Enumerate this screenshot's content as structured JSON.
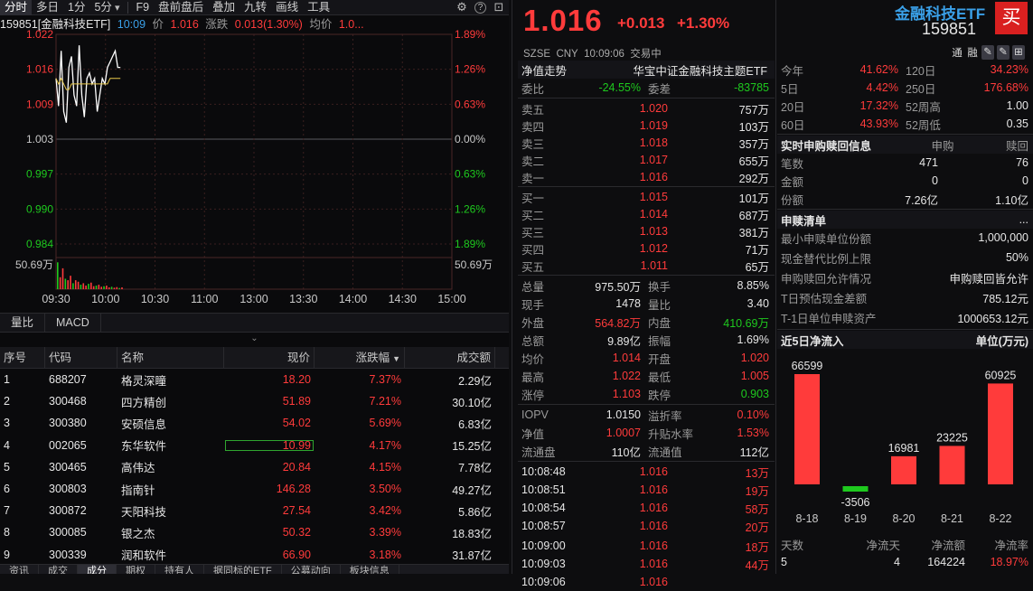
{
  "toolbar": {
    "items": [
      "分时",
      "多日",
      "1分",
      "5分",
      "F9",
      "盘前盘后",
      "叠加",
      "九转",
      "画线",
      "工具"
    ],
    "active_index": 0,
    "dropdown_chevron": "▾",
    "gear_icon": "⚙",
    "help_icon": "?",
    "ext_icon": "⊡"
  },
  "infoline": {
    "name": "159851[金融科技ETF]",
    "time": "10:09",
    "price_label": "价",
    "price": "1.016",
    "change_label": "涨跌",
    "change": "0.013(1.30%)",
    "avg_label": "均价",
    "avg": "1.0..."
  },
  "chart_data": {
    "type": "line",
    "title": "",
    "x_ticks": [
      "09:30",
      "10:00",
      "10:30",
      "11:00",
      "13:00",
      "13:30",
      "14:00",
      "14:30",
      "15:00"
    ],
    "y_ticks_price": [
      "1.022",
      "1.016",
      "1.009",
      "1.003",
      "0.997",
      "0.990",
      "0.984"
    ],
    "y_ticks_pct": [
      "1.89%",
      "1.26%",
      "0.63%",
      "0.00%",
      "0.63%",
      "1.26%",
      "1.89%"
    ],
    "ylim": [
      0.984,
      1.022
    ],
    "pre_close": 1.003,
    "volume_label": "50.69万",
    "series": [
      {
        "values": [
          1.014,
          1.009,
          1.019,
          1.008,
          1.006,
          1.016,
          1.018,
          1.011,
          1.009,
          1.02,
          1.011,
          1.007,
          1.014,
          1.015,
          1.013,
          1.014,
          1.008,
          1.011,
          1.014,
          1.013,
          1.016,
          1.017,
          1.018,
          1.019,
          1.016,
          1.016
        ]
      },
      {
        "values": [
          1.014,
          1.013,
          1.014,
          1.013,
          1.012,
          1.012,
          1.013,
          1.013,
          1.013,
          1.013,
          1.013,
          1.013,
          1.013,
          1.013,
          1.013,
          1.013,
          1.013,
          1.013,
          1.013,
          1.013,
          1.013,
          1.014,
          1.014,
          1.014,
          1.014,
          1.014
        ]
      }
    ],
    "volumes": [
      0.9,
      0.4,
      0.7,
      0.35,
      0.3,
      0.45,
      0.2,
      0.3,
      0.25,
      0.15,
      0.2,
      0.12,
      0.18,
      0.22,
      0.1,
      0.12,
      0.15,
      0.08,
      0.1,
      0.12,
      0.06,
      0.08,
      0.05,
      0.07,
      0.04,
      0.06
    ],
    "grid": true
  },
  "chart_tabs": [
    "量比",
    "MACD"
  ],
  "collapse_icon": "⌄",
  "table": {
    "headers": [
      "序号",
      "代码",
      "名称",
      "现价",
      "涨跌幅",
      "成交额"
    ],
    "sort_icon": "▼",
    "selected_row": 3,
    "rows": [
      [
        "1",
        "688207",
        "格灵深瞳",
        "18.20",
        "7.37%",
        "2.29亿"
      ],
      [
        "2",
        "300468",
        "四方精创",
        "51.89",
        "7.21%",
        "30.10亿"
      ],
      [
        "3",
        "300380",
        "安硕信息",
        "54.02",
        "5.69%",
        "6.83亿"
      ],
      [
        "4",
        "002065",
        "东华软件",
        "10.99",
        "4.17%",
        "15.25亿"
      ],
      [
        "5",
        "300465",
        "高伟达",
        "20.84",
        "4.15%",
        "7.78亿"
      ],
      [
        "6",
        "300803",
        "指南针",
        "146.28",
        "3.50%",
        "49.27亿"
      ],
      [
        "7",
        "300872",
        "天阳科技",
        "27.54",
        "3.42%",
        "5.86亿"
      ],
      [
        "8",
        "300085",
        "银之杰",
        "50.32",
        "3.39%",
        "18.83亿"
      ],
      [
        "9",
        "300339",
        "润和软件",
        "66.90",
        "3.18%",
        "31.87亿"
      ]
    ]
  },
  "bottom_tabs": [
    "资讯",
    "成交",
    "成分",
    "期权",
    "持有人",
    "据同标的ETF",
    "公募动向",
    "板块信息"
  ],
  "bottom_tab_active": 2,
  "quote": {
    "price": "1.016",
    "change": "+0.013",
    "change_pct": "+1.30%",
    "exchange": "SZSE",
    "currency": "CNY",
    "time": "10:09:06",
    "status": "交易中",
    "nav_label": "净值走势",
    "index_name": "华宝中证金融科技主题ETF",
    "weibi_label": "委比",
    "weibi": "-24.55%",
    "weicha_label": "委差",
    "weicha": "-83785",
    "asks": [
      [
        "卖五",
        "1.020",
        "757万"
      ],
      [
        "卖四",
        "1.019",
        "103万"
      ],
      [
        "卖三",
        "1.018",
        "357万"
      ],
      [
        "卖二",
        "1.017",
        "655万"
      ],
      [
        "卖一",
        "1.016",
        "292万"
      ]
    ],
    "bids": [
      [
        "买一",
        "1.015",
        "101万"
      ],
      [
        "买二",
        "1.014",
        "687万"
      ],
      [
        "买三",
        "1.013",
        "381万"
      ],
      [
        "买四",
        "1.012",
        "71万"
      ],
      [
        "买五",
        "1.011",
        "65万"
      ]
    ],
    "stats": [
      [
        "总量",
        "975.50万",
        "换手",
        "8.85%"
      ],
      [
        "现手",
        "1478",
        "量比",
        "3.40"
      ],
      [
        "外盘",
        "564.82万",
        "内盘",
        "410.69万"
      ],
      [
        "总额",
        "9.89亿",
        "振幅",
        "1.69%"
      ],
      [
        "均价",
        "1.014",
        "开盘",
        "1.020"
      ],
      [
        "最高",
        "1.022",
        "最低",
        "1.005"
      ],
      [
        "涨停",
        "1.103",
        "跌停",
        "0.903"
      ]
    ],
    "iopv": [
      [
        "IOPV",
        "1.0150",
        "溢折率",
        "0.10%"
      ],
      [
        "净值",
        "1.0007",
        "升贴水率",
        "1.53%"
      ],
      [
        "流通盘",
        "110亿",
        "流通值",
        "112亿"
      ]
    ],
    "ticks": [
      [
        "10:08:48",
        "1.016",
        "13万"
      ],
      [
        "10:08:51",
        "1.016",
        "19万"
      ],
      [
        "10:08:54",
        "1.016",
        "58万"
      ],
      [
        "10:08:57",
        "1.016",
        "20万"
      ],
      [
        "10:09:00",
        "1.016",
        "18万"
      ],
      [
        "10:09:03",
        "1.016",
        "44万"
      ],
      [
        "10:09:06",
        "1.016",
        ""
      ]
    ]
  },
  "fund": {
    "title": "金融科技ETF",
    "code": "159851",
    "buy_label": "买",
    "tools": [
      "通",
      "融",
      "✎",
      "✎",
      "⊞"
    ],
    "perf": [
      [
        "今年",
        "41.62%",
        "120日",
        "34.23%"
      ],
      [
        "5日",
        "4.42%",
        "250日",
        "176.68%"
      ],
      [
        "20日",
        "17.32%",
        "52周高",
        "1.00"
      ],
      [
        "60日",
        "43.93%",
        "52周低",
        "0.35"
      ]
    ],
    "rt_header": [
      "实时申购赎回信息",
      "申购",
      "赎回"
    ],
    "rt_rows": [
      [
        "笔数",
        "471",
        "76"
      ],
      [
        "金额",
        "0",
        "0"
      ],
      [
        "份额",
        "7.26亿",
        "1.10亿"
      ]
    ],
    "list_title": "申赎清单",
    "list_more": "...",
    "list_rows": [
      [
        "最小申赎单位份额",
        "1,000,000"
      ],
      [
        "现金替代比例上限",
        "50%"
      ],
      [
        "申购赎回允许情况",
        "申购赎回皆允许"
      ],
      [
        "T日预估现金差额",
        "785.12元"
      ],
      [
        "T-1日单位申赎资产",
        "1000653.12元"
      ]
    ],
    "flow_title": "近5日净流入",
    "flow_unit": "单位(万元)",
    "flow_chart": {
      "type": "bar",
      "categories": [
        "8-18",
        "8-19",
        "8-20",
        "8-21",
        "8-22"
      ],
      "values": [
        66599,
        -3506,
        16981,
        23225,
        60925
      ]
    },
    "summary_header": [
      "天数",
      "净流天",
      "净流额",
      "净流率"
    ],
    "summary_row": [
      "5",
      "4",
      "164224",
      "18.97%"
    ],
    "colors": {
      "up": "#ff3b3b",
      "down": "#1ec91e"
    }
  }
}
